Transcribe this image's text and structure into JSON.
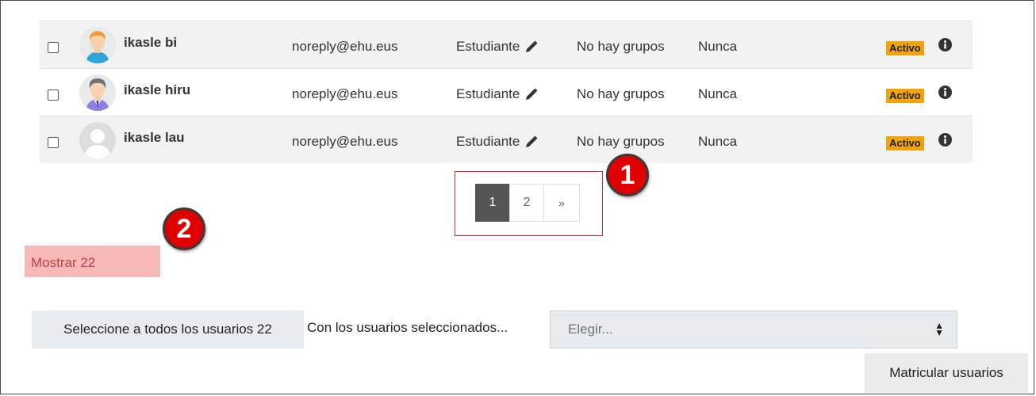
{
  "users": [
    {
      "name": "ikasle bi",
      "email": "noreply@ehu.eus",
      "role": "Estudiante",
      "groups": "No hay grupos",
      "last_access": "Nunca",
      "status": "Activo",
      "avatar": "boy-avatar"
    },
    {
      "name": "ikasle hiru",
      "email": "noreply@ehu.eus",
      "role": "Estudiante",
      "groups": "No hay grupos",
      "last_access": "Nunca",
      "status": "Activo",
      "avatar": "man-avatar"
    },
    {
      "name": "ikasle lau",
      "email": "noreply@ehu.eus",
      "role": "Estudiante",
      "groups": "No hay grupos",
      "last_access": "Nunca",
      "status": "Activo",
      "avatar": "default-avatar"
    }
  ],
  "pagination": {
    "pages": [
      "1",
      "2"
    ],
    "next": "»",
    "current": "1"
  },
  "markers": {
    "one": "1",
    "two": "2"
  },
  "show_all_label": "Mostrar 22",
  "bulk": {
    "select_all_label": "Seleccione a todos los usuarios 22",
    "with_selected_label": "Con los usuarios seleccionados...",
    "choose_placeholder": "Elegir...",
    "enrol_button": "Matricular usuarios"
  },
  "colors": {
    "badge": "#f0a30a",
    "marker": "#e00000",
    "highlight": "#f7b8b8",
    "page_active": "#555555"
  }
}
